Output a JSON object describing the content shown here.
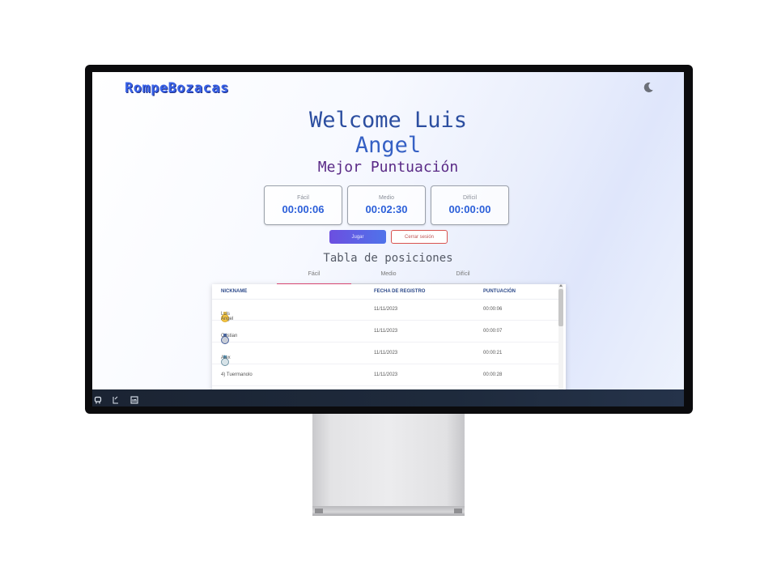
{
  "header": {
    "logo_text": "RompeBozacas",
    "theme_icon": "moon-icon"
  },
  "welcome": {
    "line1": "Welcome Luis",
    "line2": "Angel"
  },
  "best_score": {
    "title": "Mejor Puntuación",
    "cards": [
      {
        "label": "Fácil",
        "value": "00:00:06"
      },
      {
        "label": "Medio",
        "value": "00:02:30"
      },
      {
        "label": "Difícil",
        "value": "00:00:00"
      }
    ]
  },
  "actions": {
    "play_label": "Jugar",
    "logout_label": "Cerrar sesión"
  },
  "leaderboard": {
    "title": "Tabla de posiciones",
    "tabs": [
      "Fácil",
      "Medio",
      "Difícil"
    ],
    "active_tab": "Fácil",
    "columns": [
      "NICKNAME",
      "FECHA DE REGISTRO",
      "PUNTUACIÓN"
    ],
    "rows": [
      {
        "nickname": "Luis Angel",
        "date": "11/11/2023",
        "score": "00:00:06",
        "medal": "gold"
      },
      {
        "nickname": "Cristian",
        "date": "11/11/2023",
        "score": "00:00:07",
        "medal": "silver"
      },
      {
        "nickname": "Alex",
        "date": "11/11/2023",
        "score": "00:00:21",
        "medal": "bronze"
      },
      {
        "nickname": "4) Tuermanolo",
        "date": "11/11/2023",
        "score": "00:00:28",
        "medal": ""
      }
    ]
  },
  "footer": {
    "icons": [
      "github-icon",
      "gitlab-icon",
      "linkedin-icon"
    ]
  },
  "colors": {
    "accent": "#2b5fd9",
    "logout": "#d9534f",
    "footer_bg": "#1e2a3c"
  }
}
